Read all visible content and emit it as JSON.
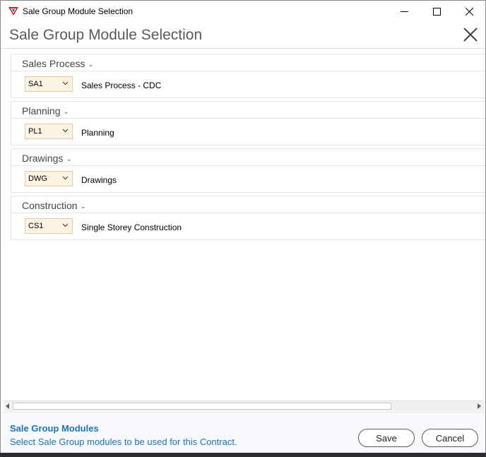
{
  "window": {
    "title": "Sale Group Module Selection",
    "controls": {
      "minimize": "minimize-icon",
      "maximize": "maximize-icon",
      "close": "close-icon"
    }
  },
  "header": {
    "title": "Sale Group Module Selection",
    "close_icon": "close-icon"
  },
  "groups": [
    {
      "title": "Sales Process",
      "code": "SA1",
      "name": "Sales Process - CDC"
    },
    {
      "title": "Planning",
      "code": "PL1",
      "name": "Planning"
    },
    {
      "title": "Drawings",
      "code": "DWG",
      "name": "Drawings"
    },
    {
      "title": "Construction",
      "code": "CS1",
      "name": "Single Storey Construction"
    }
  ],
  "footer": {
    "title": "Sale Group Modules",
    "description": "Select Sale Group modules to be used for this Contract.",
    "save_label": "Save",
    "cancel_label": "Cancel"
  },
  "colors": {
    "accent": "#1e73b8",
    "dropdown_bg": "#fdf3e3",
    "dropdown_border": "#e4c8a0"
  }
}
